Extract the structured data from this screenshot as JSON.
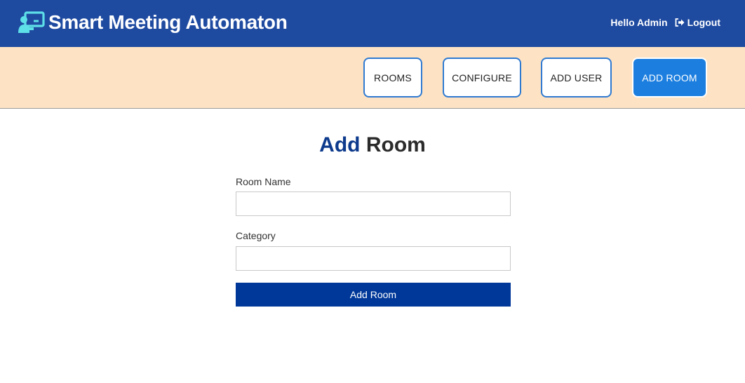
{
  "header": {
    "brand_title": "Smart Meeting Automaton",
    "brand_icon": "presentation-user-icon",
    "greeting": "Hello Admin",
    "logout_label": "Logout",
    "logout_icon": "sign-out-icon",
    "background_color": "#1e4aa0",
    "icon_color": "#5ee0e8"
  },
  "nav": {
    "background_color": "#fde3c4",
    "active_color": "#1c7fe0",
    "items": [
      {
        "label": "ROOMS",
        "active": false
      },
      {
        "label": "CONFIGURE",
        "active": false
      },
      {
        "label": "ADD USER",
        "active": false
      },
      {
        "label": "ADD ROOM",
        "active": true
      }
    ]
  },
  "page": {
    "title_accent": "Add",
    "title_rest": "Room",
    "title_accent_color": "#0d3a8c"
  },
  "form": {
    "room_name_label": "Room Name",
    "room_name_value": "",
    "category_label": "Category",
    "category_value": "",
    "submit_label": "Add Room",
    "submit_color": "#003899"
  }
}
